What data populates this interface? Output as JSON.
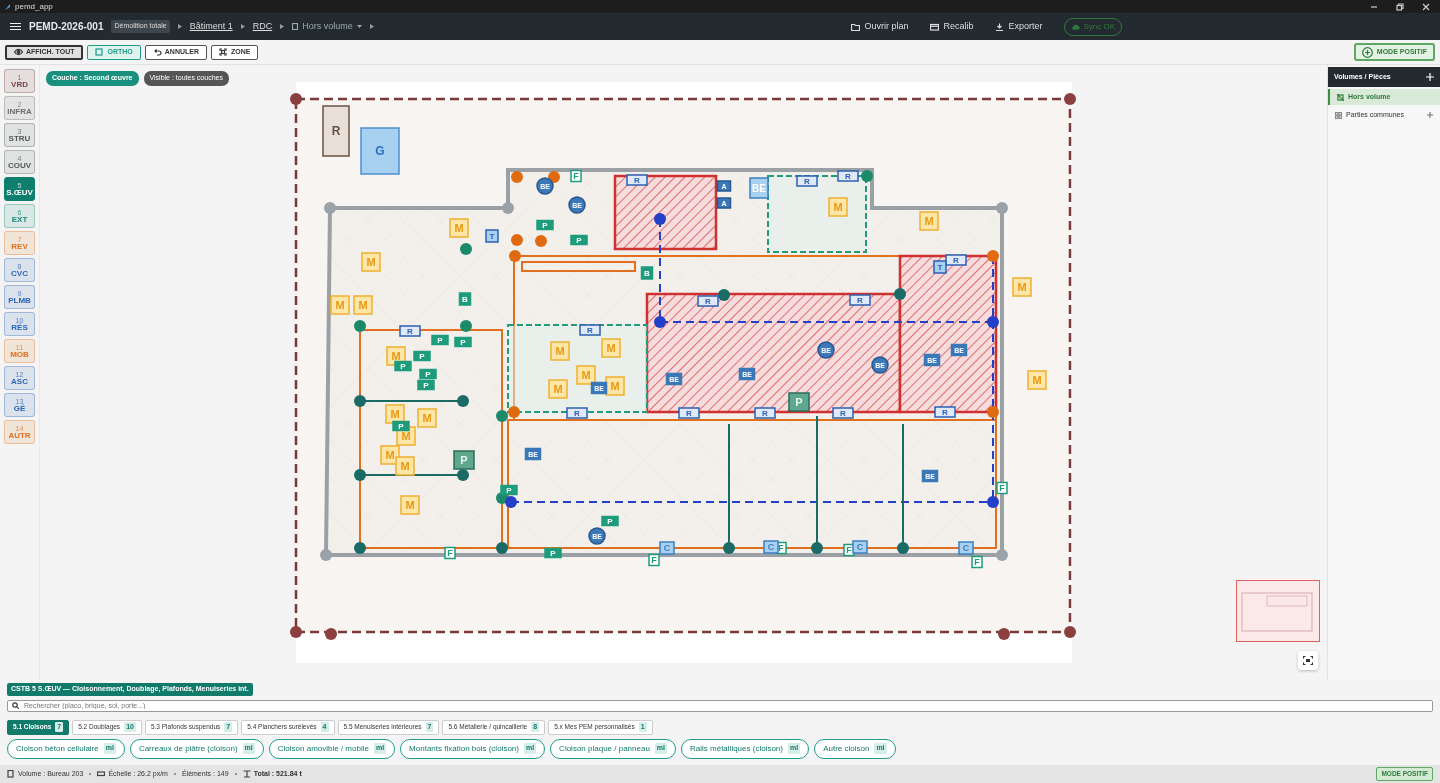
{
  "window": {
    "title": "pemd_app"
  },
  "header": {
    "project": "PEMD-2026-001",
    "project_badge": "Démolition totale",
    "breadcrumb": [
      {
        "label": "Bâtiment 1",
        "kind": "plain"
      },
      {
        "label": "RDC",
        "kind": "plain"
      },
      {
        "label": "Hors volume",
        "kind": "dropdown"
      }
    ],
    "actions": [
      {
        "label": "Ouvrir plan",
        "kind": "folder"
      },
      {
        "label": "Recalib",
        "kind": "card"
      },
      {
        "label": "Exporter",
        "kind": "download"
      }
    ],
    "sync": "Sync OK"
  },
  "toolbar": {
    "buttons": [
      {
        "label": "AFFICH. TOUT",
        "kind": "eye",
        "selected": true
      },
      {
        "label": "ORTHO",
        "kind": "square",
        "selected": true
      },
      {
        "label": "ANNULER",
        "kind": "undo",
        "selected": false
      },
      {
        "label": "ZONE",
        "kind": "frame",
        "selected": false
      }
    ],
    "mode": "MODE POSITIF"
  },
  "layers": [
    {
      "num": "1",
      "label": "VRD",
      "color": "#7a4444",
      "selected": false
    },
    {
      "num": "2",
      "label": "INFRA",
      "color": "#6b6f73",
      "selected": false
    },
    {
      "num": "3",
      "label": "STRU",
      "color": "#55595d",
      "selected": false
    },
    {
      "num": "4",
      "label": "COUV",
      "color": "#55595d",
      "selected": false
    },
    {
      "num": "5",
      "label": "S.ŒUV",
      "color": "#0e7e6e",
      "selected": true
    },
    {
      "num": "6",
      "label": "EXT",
      "color": "#1a8a78",
      "selected": false
    },
    {
      "num": "7",
      "label": "REV",
      "color": "#e0701c",
      "selected": false
    },
    {
      "num": "8",
      "label": "CVC",
      "color": "#2a66b8",
      "selected": false
    },
    {
      "num": "9",
      "label": "PLMB",
      "color": "#2a66b8",
      "selected": false
    },
    {
      "num": "10",
      "label": "RÉS",
      "color": "#2a66b8",
      "selected": false
    },
    {
      "num": "11",
      "label": "MOB",
      "color": "#e0701c",
      "selected": false
    },
    {
      "num": "12",
      "label": "ASC",
      "color": "#2a66b8",
      "selected": false
    },
    {
      "num": "13",
      "label": "GÉ",
      "color": "#2a66b8",
      "selected": false
    },
    {
      "num": "14",
      "label": "AUTR",
      "color": "#e0701c",
      "selected": false
    }
  ],
  "canvas": {
    "chips": [
      {
        "label": "Couche : Second œuvre",
        "kind": "layer"
      },
      {
        "label": "Visible : toutes couches",
        "kind": "visibility"
      }
    ],
    "markers": [
      {
        "kind": "rbox",
        "label": "R"
      },
      {
        "kind": "gtag",
        "label": "G"
      },
      {
        "kind": "mtag",
        "label": "M"
      },
      {
        "kind": "mtag",
        "label": "M"
      },
      {
        "kind": "mtag",
        "label": "M"
      },
      {
        "kind": "mtag",
        "label": "M"
      },
      {
        "kind": "mtag",
        "label": "M"
      },
      {
        "kind": "mtag",
        "label": "M"
      },
      {
        "kind": "mtag",
        "label": "M"
      },
      {
        "kind": "mtag",
        "label": "M"
      },
      {
        "kind": "mtag",
        "label": "M"
      },
      {
        "kind": "mtag",
        "label": "M"
      },
      {
        "kind": "mtag",
        "label": "M"
      },
      {
        "kind": "mtag",
        "label": "M"
      },
      {
        "kind": "mtag",
        "label": "M"
      },
      {
        "kind": "mtag",
        "label": "M"
      },
      {
        "kind": "mtag",
        "label": "M"
      },
      {
        "kind": "mtag",
        "label": "M"
      },
      {
        "kind": "mtag",
        "label": "M"
      },
      {
        "kind": "mtag",
        "label": "M"
      },
      {
        "kind": "mtag",
        "label": "M"
      },
      {
        "kind": "mtag",
        "label": "M"
      },
      {
        "kind": "ptag",
        "label": "P"
      },
      {
        "kind": "ptag",
        "label": "P"
      },
      {
        "kind": "ptag",
        "label": "P"
      },
      {
        "kind": "ptag",
        "label": "P"
      },
      {
        "kind": "ptag",
        "label": "P"
      },
      {
        "kind": "ptag",
        "label": "P"
      },
      {
        "kind": "ptag",
        "label": "P"
      },
      {
        "kind": "ptag",
        "label": "P"
      },
      {
        "kind": "ptag",
        "label": "P"
      },
      {
        "kind": "ptag",
        "label": "P"
      },
      {
        "kind": "ptag",
        "label": "P"
      },
      {
        "kind": "ptag",
        "label": "P"
      },
      {
        "kind": "pbox",
        "label": "P"
      },
      {
        "kind": "pbox",
        "label": "P"
      },
      {
        "kind": "rtag",
        "label": "R"
      },
      {
        "kind": "rtag",
        "label": "R"
      },
      {
        "kind": "rtag",
        "label": "R"
      },
      {
        "kind": "rtag",
        "label": "R"
      },
      {
        "kind": "rtag",
        "label": "R"
      },
      {
        "kind": "rtag",
        "label": "R"
      },
      {
        "kind": "rtag",
        "label": "R"
      },
      {
        "kind": "rtag",
        "label": "R"
      },
      {
        "kind": "rtag",
        "label": "R"
      },
      {
        "kind": "rtag",
        "label": "R"
      },
      {
        "kind": "rtag",
        "label": "R"
      },
      {
        "kind": "rtag",
        "label": "R"
      },
      {
        "kind": "rtag",
        "label": "R"
      },
      {
        "kind": "becircle",
        "label": "BE"
      },
      {
        "kind": "becircle",
        "label": "BE"
      },
      {
        "kind": "bebox",
        "label": "BE"
      },
      {
        "kind": "becircle",
        "label": "BE"
      },
      {
        "kind": "becircle",
        "label": "BE"
      },
      {
        "kind": "betag",
        "label": "BE"
      },
      {
        "kind": "betag",
        "label": "BE"
      },
      {
        "kind": "betag",
        "label": "BE"
      },
      {
        "kind": "betag",
        "label": "BE"
      },
      {
        "kind": "betag",
        "label": "BE"
      },
      {
        "kind": "betag",
        "label": "BE"
      },
      {
        "kind": "betag",
        "label": "BE"
      },
      {
        "kind": "becircle",
        "label": "BE"
      },
      {
        "kind": "ftag",
        "label": "F"
      },
      {
        "kind": "ftag",
        "label": "F"
      },
      {
        "kind": "ftag",
        "label": "F"
      },
      {
        "kind": "ftag",
        "label": "F"
      },
      {
        "kind": "ftag",
        "label": "F"
      },
      {
        "kind": "ftag",
        "label": "F"
      },
      {
        "kind": "ftag",
        "label": "F"
      },
      {
        "kind": "atag",
        "label": "A"
      },
      {
        "kind": "atag",
        "label": "A"
      },
      {
        "kind": "btag",
        "label": "B"
      },
      {
        "kind": "btag",
        "label": "B"
      },
      {
        "kind": "ctag",
        "label": "C"
      },
      {
        "kind": "ctag",
        "label": "C"
      },
      {
        "kind": "ctag",
        "label": "C"
      },
      {
        "kind": "ctag",
        "label": "C"
      },
      {
        "kind": "ttag",
        "label": "T"
      },
      {
        "kind": "ttag",
        "label": "T"
      }
    ]
  },
  "volumes": {
    "title": "Volumes / Pièces",
    "items": [
      {
        "label": "Hors volume",
        "kind": "outside",
        "selected": true
      },
      {
        "label": "Parties communes",
        "kind": "common",
        "selected": false
      }
    ]
  },
  "catalog": {
    "title": "CSTB 5 S.ŒUV — Cloisonnement, Doublage, Plafonds, Menuiseries int.",
    "search": {
      "placeholder": "Rechercher (placo, brique, sol, porte...)"
    },
    "tabs": [
      {
        "label": "5.1 Cloisons",
        "count": "7",
        "selected": true
      },
      {
        "label": "5.2 Doublages",
        "count": "10",
        "selected": false
      },
      {
        "label": "5.3 Plafonds suspendus",
        "count": "7",
        "selected": false
      },
      {
        "label": "5.4 Planchers surélevés",
        "count": "4",
        "selected": false
      },
      {
        "label": "5.5 Menuiseries intérieures",
        "count": "7",
        "selected": false
      },
      {
        "label": "5.6 Métallerie / quincaillerie",
        "count": "8",
        "selected": false
      },
      {
        "label": "5.x Mes PEM personnalisés",
        "count": "1",
        "selected": false
      }
    ],
    "items": [
      {
        "label": "Cloison béton cellulaire",
        "unit": "ml"
      },
      {
        "label": "Carreaux de plâtre (cloison)",
        "unit": "ml"
      },
      {
        "label": "Cloison amovible / mobile",
        "unit": "ml"
      },
      {
        "label": "Montants fixation bois (cloison)",
        "unit": "ml"
      },
      {
        "label": "Cloison plaque / panneau",
        "unit": "ml"
      },
      {
        "label": "Rails métalliques (cloison)",
        "unit": "ml"
      },
      {
        "label": "Autre cloison",
        "unit": "ml"
      }
    ]
  },
  "status_bar": {
    "items": [
      {
        "label": "Volume : Bureau 203",
        "kind": "volume"
      },
      {
        "label": "Échelle : 26.2 px/m",
        "kind": "scale"
      },
      {
        "label": "Éléments : 149",
        "kind": "count"
      },
      {
        "label": "Total : 521.84 t",
        "kind": "total"
      }
    ],
    "mode": "MODE POSITIF"
  }
}
